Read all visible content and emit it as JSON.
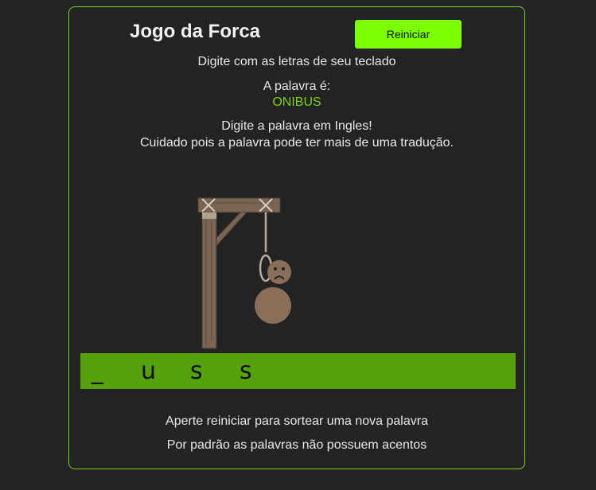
{
  "header": {
    "title": "Jogo da Forca",
    "restart_label": "Reiniciar"
  },
  "instructions": {
    "keyboard": "Digite com as letras de seu teclado",
    "word_label": "A palavra é:",
    "word": "ONIBUS",
    "english_hint": "Digite a palavra em Ingles!",
    "warning": "Cuidado pois a palavra pode ter mais de uma tradução."
  },
  "guess": {
    "slots": [
      "_",
      "u",
      "s",
      "s"
    ]
  },
  "footer": {
    "restart_hint": "Aperte reiniciar para sortear uma nova palavra",
    "accents_hint": "Por padrão as palavras não possuem acentos"
  },
  "colors": {
    "accent": "#7cff00",
    "word_bar": "#55a10e",
    "background": "#232323",
    "gallows_wood": "#7a6452",
    "figure": "#8a6e58"
  },
  "icons": [
    "gallows-icon",
    "sad-face-icon"
  ]
}
